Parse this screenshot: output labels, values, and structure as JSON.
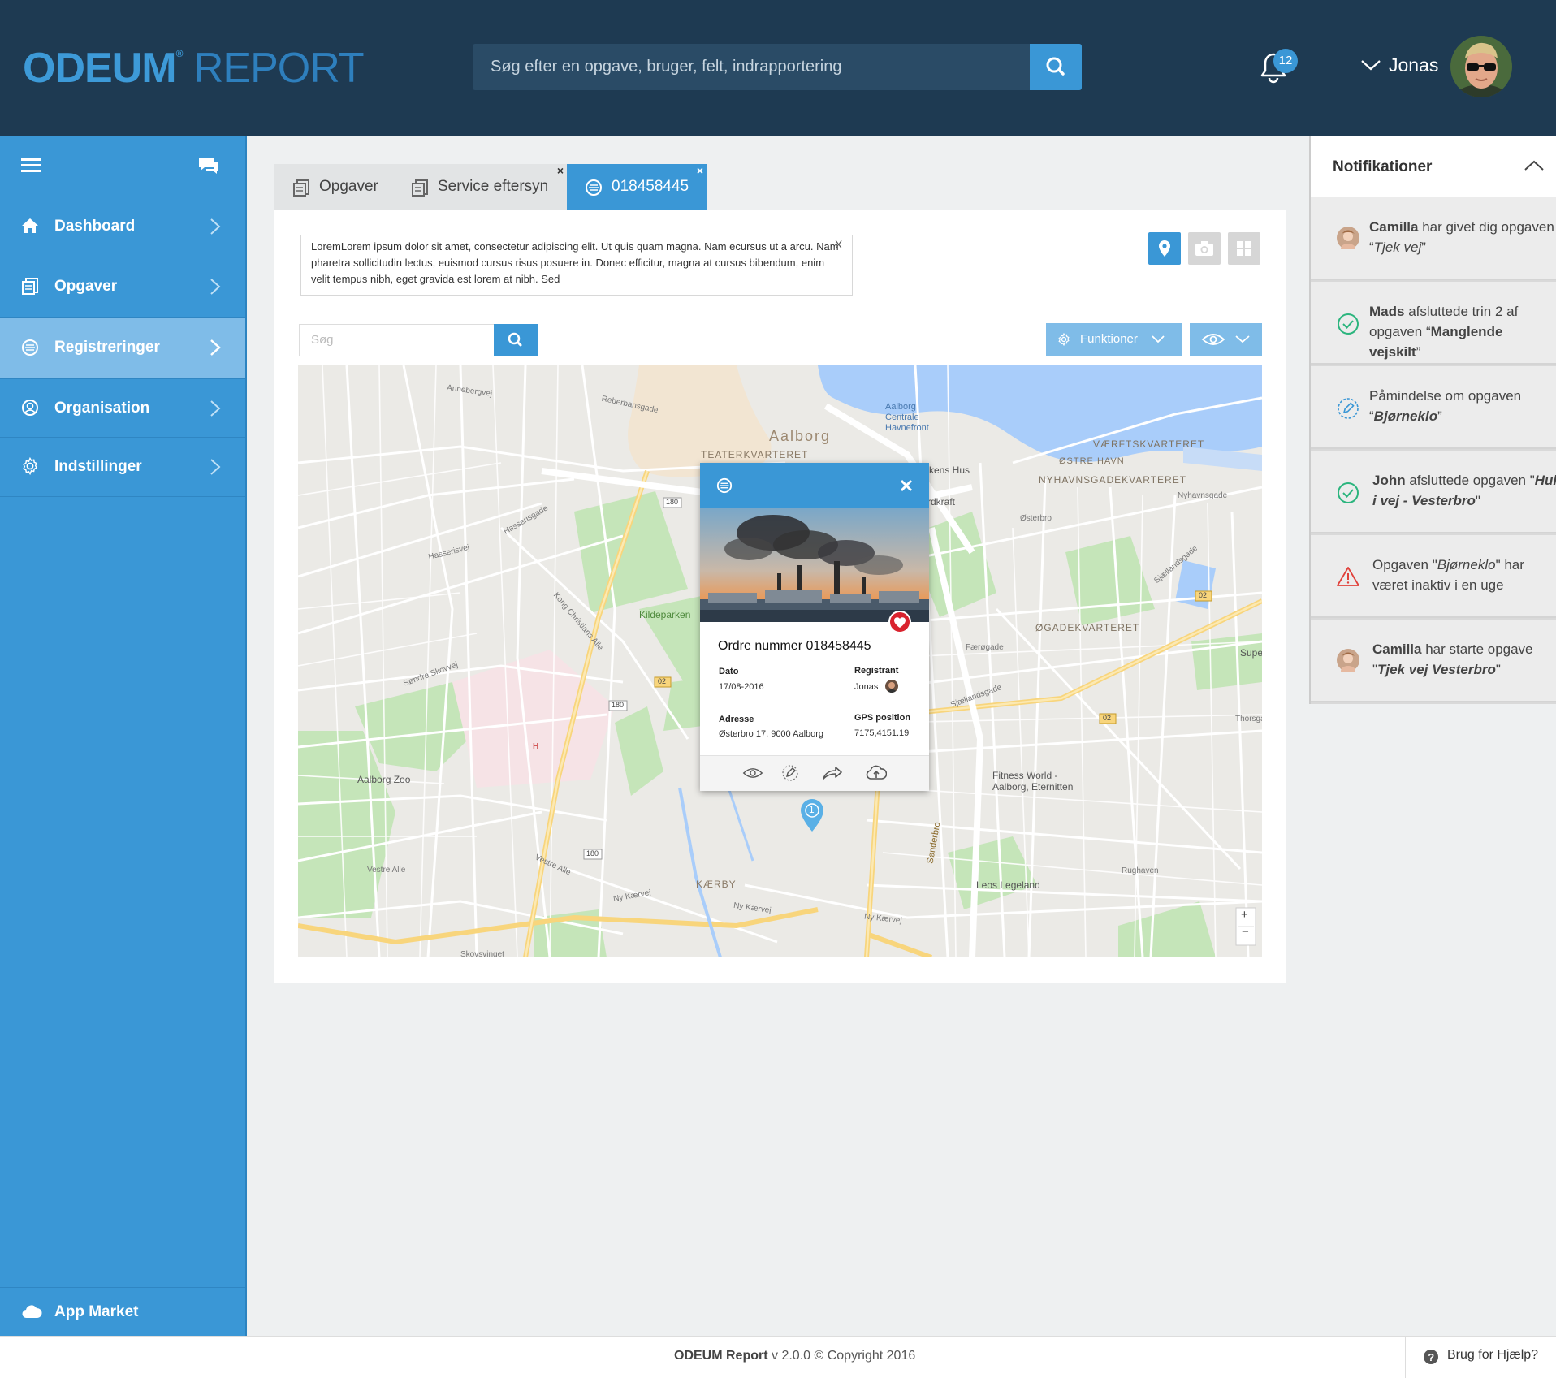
{
  "header": {
    "logo_odeum": "ODEUM",
    "logo_reg": "®",
    "logo_report": "REPORT",
    "search_placeholder": "Søg efter en opgave, bruger, felt, indrapportering",
    "notification_count": "12",
    "user_name": "Jonas"
  },
  "sidebar": {
    "items": [
      {
        "label": "Dashboard"
      },
      {
        "label": "Opgaver"
      },
      {
        "label": "Registreringer"
      },
      {
        "label": "Organisation"
      },
      {
        "label": "Indstillinger"
      }
    ],
    "app_market": "App Market"
  },
  "tabs": [
    {
      "label": "Opgaver"
    },
    {
      "label": "Service eftersyn",
      "close": "×"
    },
    {
      "label": "018458445",
      "close": "×"
    }
  ],
  "content": {
    "note_text": "LoremLorem ipsum dolor sit amet, consectetur adipiscing elit. Ut quis quam magna. Nam ecursus ut a arcu. Nam pharetra sollicitudin lectus, euismod cursus risus posuere in. Donec efficitur, magna at cursus bibendum, enim velit tempus nibh, eget gravida est lorem at nibh. Sed",
    "note_close": "X",
    "search_placeholder": "Søg",
    "funktioner_label": "Funktioner"
  },
  "map": {
    "labels": {
      "aalborg": "Aalborg",
      "teaterkvarteret": "TEATERKVARTERET",
      "havnefront": "Aalborg\nCentrale\nHavnefront",
      "vaerft": "VÆRFTSKVARTERET",
      "ostre_havn": "ØSTRE HAVN",
      "nyhavn_kv": "NYHAVNSGADEKVARTERET",
      "ogade": "ØGADEKVARTERET",
      "kildeparken": "Kildeparken",
      "kaerby": "KÆRBY",
      "zoo": "Aalborg Zoo",
      "fitness": "Fitness World -\nAalborg, Eternitten",
      "leos": "Leos Legeland",
      "annebergvej": "Annebergvej",
      "reberbansgade": "Reberbansgade",
      "hasserisvej": "Hasserisvej",
      "hasserisgade": "Hasserisgade",
      "kong_christians": "Kong Christians Alle",
      "sondre_skovvej": "Søndre Skovvej",
      "vestre_alle": "Vestre Alle",
      "vestre_alle2": "Vestre Alle",
      "ny_kaervej": "Ny Kærvej",
      "ny_kaervej2": "Ny Kærvej",
      "ny_kaervej3": "Ny Kærvej",
      "sonderbro": "Sønderbro",
      "nyhavnsgade": "Nyhavnsgade",
      "osterbro": "Østerbro",
      "sjaellandsgade": "Sjællandsgade",
      "sjaellandsgade2": "Sjællandsgade",
      "faeroegade": "Færøgade",
      "thorsgade": "Thorsgade",
      "rughaven": "Rughaven",
      "skovsvinget": "Skovsvinget",
      "kenshus": "kens Hus",
      "kraft": "rdkraft",
      "supe": "Supe",
      "r180a": "180",
      "r180b": "180",
      "r180c": "180",
      "r02a": "02",
      "r02b": "02",
      "r02c": "02",
      "marker_num": "1",
      "zoom_in": "+",
      "zoom_out": "−"
    }
  },
  "popup": {
    "title": "Ordre nummer 018458445",
    "dato_label": "Dato",
    "dato_value": "17/08-2016",
    "registrant_label": "Registrant",
    "registrant_value": "Jonas",
    "adresse_label": "Adresse",
    "adresse_value": "Østerbro 17, 9000 Aalborg",
    "gps_label": "GPS position",
    "gps_value": "7175,4151.19"
  },
  "notifications": {
    "title": "Notifikationer",
    "items": [
      {
        "icon": "avatar",
        "bold": "Camilla",
        "text": " har givet dig opgaven “",
        "italic": "Tjek vej",
        "end": "”"
      },
      {
        "icon": "check-icon",
        "bold": "Mads",
        "text": " afsluttede trin 2 af opgaven “",
        "italic": "Manglende vejskilt",
        "end": "”"
      },
      {
        "icon": "edit-icon",
        "bold": "",
        "text": "Påmindelse om opgaven “",
        "italic": "Bjørneklo",
        "end": "”"
      },
      {
        "icon": "check-icon",
        "bold": "John",
        "text": " afsluttede opgaven \"",
        "italic": "Hul i vej - Vesterbro",
        "end": "\""
      },
      {
        "icon": "warning-icon",
        "bold": "",
        "text": "Opgaven \"",
        "italic": "Bjørneklo",
        "end": "\" har været inaktiv i en uge"
      },
      {
        "icon": "avatar",
        "bold": "Camilla",
        "text": " har starte opgave \"",
        "italic": "Tjek vej Vesterbro",
        "end": "\""
      }
    ]
  },
  "footer": {
    "brand": "ODEUM Report",
    "copyright": " v 2.0.0 © Copyright 2016",
    "help": "Brug for Hjælp?"
  },
  "colors": {
    "header_bg": "#1e3a52",
    "accent": "#3a97d6",
    "sidebar_active": "#7fbce8",
    "heart": "#d9232e"
  }
}
